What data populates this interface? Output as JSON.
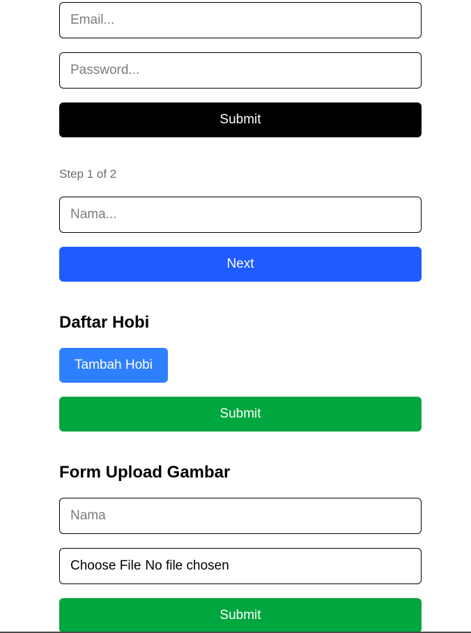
{
  "login_form": {
    "email_placeholder": "Email...",
    "password_placeholder": "Password...",
    "submit_label": "Submit"
  },
  "step_form": {
    "step_text": "Step 1 of 2",
    "name_placeholder": "Nama...",
    "next_label": "Next"
  },
  "hobby_section": {
    "title": "Daftar Hobi",
    "add_label": "Tambah Hobi",
    "submit_label": "Submit"
  },
  "upload_section": {
    "title": "Form Upload Gambar",
    "name_placeholder": "Nama",
    "choose_file_label": "Choose File",
    "file_status": "No file chosen",
    "submit_label": "Submit"
  },
  "colors": {
    "black_button": "#000000",
    "blue_button": "#1f5bff",
    "light_blue_button": "#2f80ff",
    "green_button": "#00a63e"
  }
}
